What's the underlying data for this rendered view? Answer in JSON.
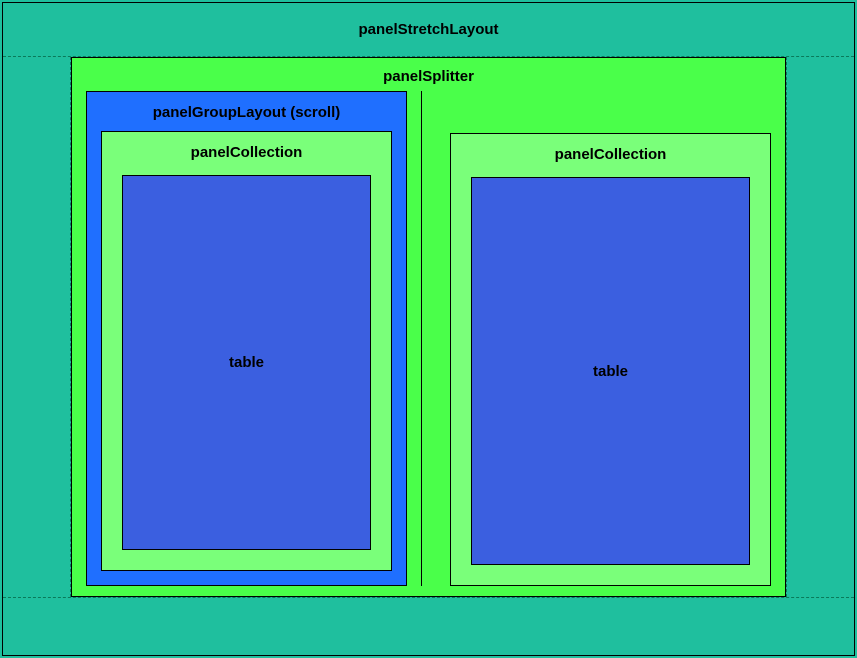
{
  "layout": {
    "title": "panelStretchLayout",
    "splitter": {
      "title": "panelSplitter",
      "left": {
        "groupLayout": {
          "title": "panelGroupLayout (scroll)",
          "collection": {
            "title": "panelCollection",
            "table": {
              "label": "table"
            }
          }
        }
      },
      "right": {
        "collection": {
          "title": "panelCollection",
          "table": {
            "label": "table"
          }
        }
      }
    }
  }
}
